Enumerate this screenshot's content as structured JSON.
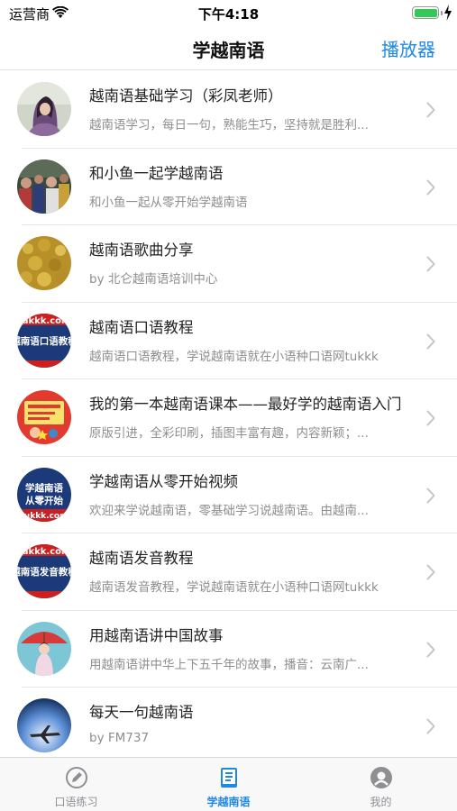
{
  "status": {
    "carrier": "运营商",
    "time": "下午4:18"
  },
  "nav": {
    "title": "学越南语",
    "right_button": "播放器"
  },
  "colors": {
    "accent": "#1e88e5",
    "battery": "#34c759",
    "separator": "#e6e6e6"
  },
  "list": [
    {
      "title": "越南语基础学习（彩凤老师）",
      "subtitle": "越南语学习，每日一句，熟能生巧，坚持就是胜利...",
      "avatar": "photo-girl"
    },
    {
      "title": "和小鱼一起学越南语",
      "subtitle": "和小鱼一起从零开始学越南语",
      "avatar": "photo-crowd"
    },
    {
      "title": "越南语歌曲分享",
      "subtitle": "by 北仑越南语培训中心",
      "avatar": "photo-flowers"
    },
    {
      "title": "越南语口语教程",
      "subtitle": "越南语口语教程，学说越南语就在小语种口语网tukkk",
      "avatar": "logo-tukkk",
      "avatar_text": "越南语口语教程"
    },
    {
      "title": "我的第一本越南语课本——最好学的越南语入门",
      "subtitle": "原版引进，全彩印刷，插图丰富有趣，内容新颖；...",
      "avatar": "book-cover"
    },
    {
      "title": "学越南语从零开始视频",
      "subtitle": "欢迎来学说越南语，零基础学习说越南语。由越南...",
      "avatar": "logo-tukkk",
      "avatar_text": "学越南语从零开始"
    },
    {
      "title": "越南语发音教程",
      "subtitle": "越南语发音教程，学说越南语就在小语种口语网tukkk",
      "avatar": "logo-tukkk",
      "avatar_text": "越南语发音教程"
    },
    {
      "title": "用越南语讲中国故事",
      "subtitle": "用越南语讲中华上下五千年的故事，播音：云南广...",
      "avatar": "photo-girl-umbrella"
    },
    {
      "title": "每天一句越南语",
      "subtitle": "by FM737",
      "avatar": "photo-plane"
    }
  ],
  "tabs": [
    {
      "label": "口语练习",
      "icon": "pencil-icon"
    },
    {
      "label": "学越南语",
      "icon": "book-icon",
      "active": true
    },
    {
      "label": "我的",
      "icon": "profile-icon"
    }
  ]
}
